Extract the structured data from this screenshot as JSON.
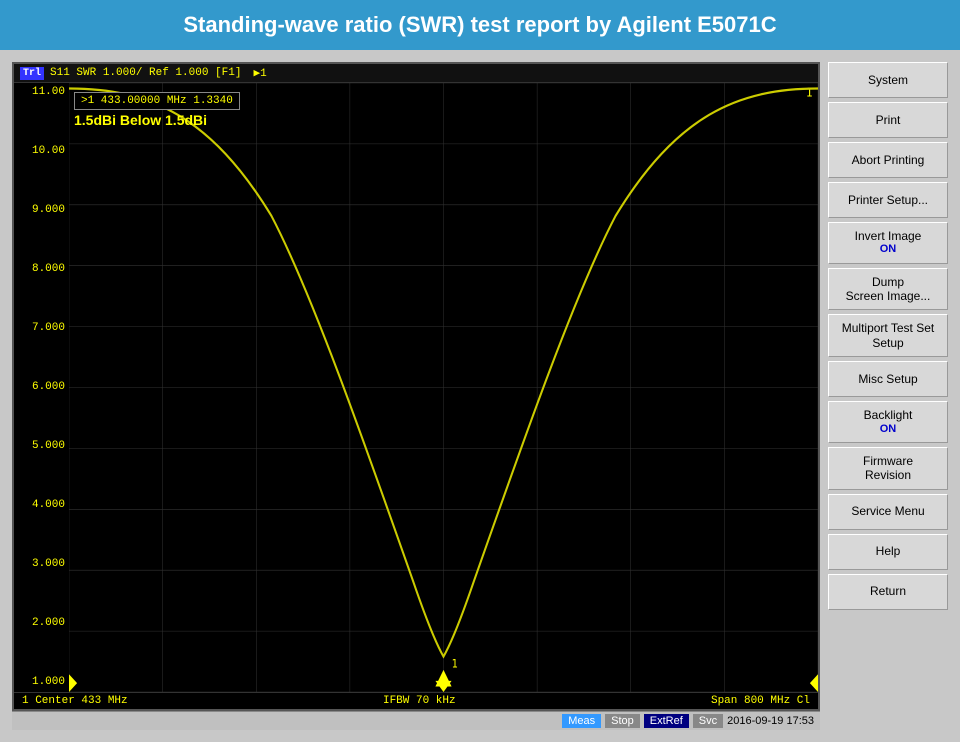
{
  "header": {
    "title": "Standing-wave ratio (SWR) test report by Agilent E5071C"
  },
  "chart": {
    "trace_label": "Trl",
    "top_bar_text": "S11  SWR 1.000/ Ref 1.000 [F1]",
    "marker_text": ">1   433.00000 MHz   1.3340",
    "annotation": "1.5dBi Below 1.5dBi",
    "y_labels": [
      "11.00",
      "10.00",
      "9.000",
      "8.000",
      "7.000",
      "6.000",
      "5.000",
      "4.000",
      "3.000",
      "2.000",
      "1.000"
    ],
    "bottom_left": "1  Center 433 MHz",
    "bottom_center": "IFBW 70 kHz",
    "bottom_right": "Span 800 MHz  Cl"
  },
  "status_bar": {
    "meas": "Meas",
    "stop": "Stop",
    "extref": "ExtRef",
    "svc": "Svc",
    "time": "2016-09-19 17:53"
  },
  "sidebar": {
    "buttons": [
      {
        "id": "system",
        "label": "System",
        "sub": ""
      },
      {
        "id": "print",
        "label": "Print",
        "sub": ""
      },
      {
        "id": "abort-printing",
        "label": "Abort Printing",
        "sub": ""
      },
      {
        "id": "printer-setup",
        "label": "Printer Setup...",
        "sub": ""
      },
      {
        "id": "invert-image",
        "label": "Invert Image",
        "sub": "ON"
      },
      {
        "id": "dump-screen",
        "label": "Dump\nScreen Image...",
        "sub": ""
      },
      {
        "id": "multiport-test",
        "label": "Multiport Test Set\nSetup",
        "sub": ""
      },
      {
        "id": "misc-setup",
        "label": "Misc Setup",
        "sub": ""
      },
      {
        "id": "backlight",
        "label": "Backlight",
        "sub": "ON"
      },
      {
        "id": "firmware-revision",
        "label": "Firmware\nRevision",
        "sub": ""
      },
      {
        "id": "service-menu",
        "label": "Service Menu",
        "sub": ""
      },
      {
        "id": "help",
        "label": "Help",
        "sub": ""
      },
      {
        "id": "return",
        "label": "Return",
        "sub": ""
      }
    ]
  }
}
